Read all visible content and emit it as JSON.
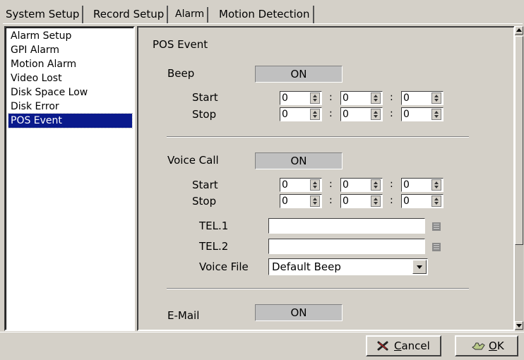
{
  "tabs": [
    {
      "label": "System Setup"
    },
    {
      "label": "Record Setup"
    },
    {
      "label": "Alarm"
    },
    {
      "label": "Motion Detection"
    }
  ],
  "sidebar": {
    "items": [
      {
        "label": "Alarm Setup"
      },
      {
        "label": "GPI Alarm"
      },
      {
        "label": "Motion Alarm"
      },
      {
        "label": "Video Lost"
      },
      {
        "label": "Disk Space Low"
      },
      {
        "label": "Disk Error"
      },
      {
        "label": "POS Event"
      }
    ],
    "selected": "POS Event"
  },
  "main": {
    "section_title": "POS Event",
    "beep": {
      "label": "Beep",
      "toggle": "ON",
      "start_label": "Start",
      "stop_label": "Stop",
      "start": [
        "0",
        "0",
        "0"
      ],
      "stop": [
        "0",
        "0",
        "0"
      ]
    },
    "voice_call": {
      "label": "Voice Call",
      "toggle": "ON",
      "start_label": "Start",
      "stop_label": "Stop",
      "start": [
        "0",
        "0",
        "0"
      ],
      "stop": [
        "0",
        "0",
        "0"
      ],
      "tel1_label": "TEL.1",
      "tel1_value": "",
      "tel2_label": "TEL.2",
      "tel2_value": "",
      "voice_file_label": "Voice File",
      "voice_file_value": "Default Beep"
    },
    "email": {
      "label": "E-Mail",
      "toggle": "ON"
    },
    "time_separator": ":"
  },
  "footer": {
    "cancel_rest": "ancel",
    "cancel_accel": "C",
    "ok_rest": "K",
    "ok_accel": "O"
  },
  "colors": {
    "window_bg": "#d4d0c8",
    "selection": "#0a1a8c",
    "toggle_bg": "#c0c0c0"
  }
}
